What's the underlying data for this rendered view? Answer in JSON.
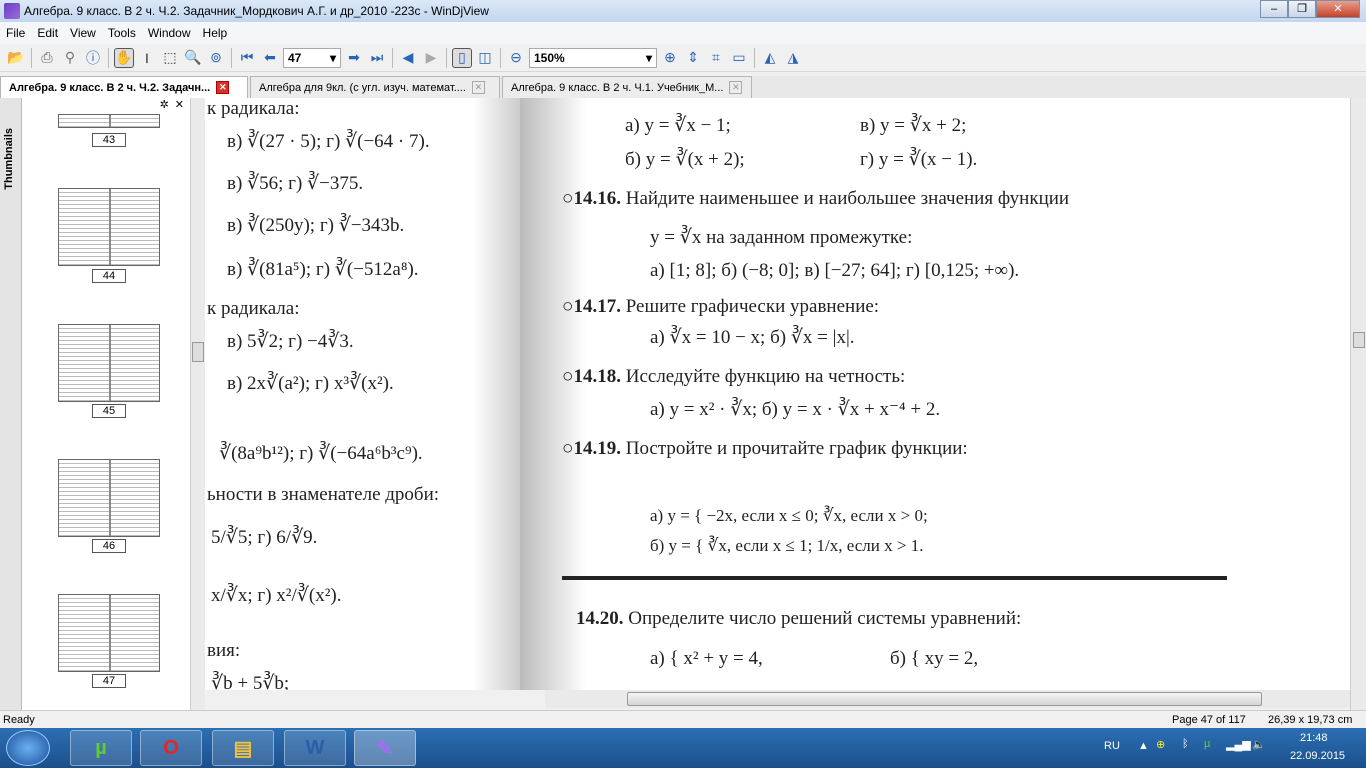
{
  "window": {
    "title": "Алгебра. 9 класс. В 2 ч. Ч.2. Задачник_Мордкович А.Г. и др_2010 -223с - WinDjView"
  },
  "menu": [
    "File",
    "Edit",
    "View",
    "Tools",
    "Window",
    "Help"
  ],
  "toolbar": {
    "page_value": "47",
    "zoom_value": "150%"
  },
  "tabs": [
    {
      "label": "Алгебра. 9 класс. В 2 ч. Ч.2. Задачн...",
      "active": true
    },
    {
      "label": "Алгебра для 9кл. (с угл. изуч. математ...."
    },
    {
      "label": "Алгебра. 9 класс. В 2 ч. Ч.1. Учебник_М..."
    }
  ],
  "sidebar": {
    "tab_label": "Thumbnails",
    "pages": [
      "43",
      "44",
      "45",
      "46",
      "47"
    ]
  },
  "left_page": [
    "к радикала:",
    "в) ∛(27 · 5);     г) ∛(−64 · 7).",
    "в) ∛56;        г) ∛−375.",
    "в) ∛(250y);     г) ∛−343b.",
    "в) ∛(81a⁵);     г) ∛(−512a⁸).",
    "к радикала:",
    "в) 5∛2;        г) −4∛3.",
    "в) 2x∛(a²);     г) x³∛(x²).",
    "∛(8a⁹b¹²);     г) ∛(−64a⁶b³c⁹).",
    "ьности в знаменателе дроби:",
    "5/∛5;       г) 6/∛9.",
    "x/∛x;       г) x²/∛(x²).",
    "вия:",
    "∛b + 5∛b;"
  ],
  "right_page": {
    "top": [
      "а) y = ∛x − 1;",
      "в) y = ∛x + 2;",
      "б) y = ∛(x + 2);",
      "г) y = ∛(x − 1)."
    ],
    "problems": [
      {
        "num": "○14.16.",
        "text": "Найдите наименьшее и наибольшее значения функции",
        "lines": [
          "y = ∛x на заданном промежутке:",
          "а) [1; 8];     б) (−8; 0];     в) [−27; 64];     г) [0,125; +∞)."
        ]
      },
      {
        "num": "○14.17.",
        "text": "Решите графически уравнение:",
        "lines": [
          "а) ∛x = 10 − x;        б) ∛x = |x|."
        ]
      },
      {
        "num": "○14.18.",
        "text": "Исследуйте функцию на четность:",
        "lines": [
          "а) y = x² · ∛x;            б) y = x · ∛x + x⁻⁴ + 2."
        ]
      },
      {
        "num": "○14.19.",
        "text": "Постройте и прочитайте график функции:",
        "lines": [
          "а) y = { −2x, если x ≤ 0;   ∛x, если x > 0;",
          "б) y = { ∛x, если x ≤ 1;   1/x, если x > 1."
        ]
      },
      {
        "num": "14.20.",
        "text": "Определите число решений системы уравнений:",
        "lines": [
          "а) { x² + y = 4,",
          "б) { xy = 2,"
        ]
      }
    ]
  },
  "status": {
    "left": "Ready",
    "page": "Page 47 of 117",
    "size": "26,39 x 19,73 cm"
  },
  "taskbar": {
    "lang": "RU",
    "time": "21:48",
    "date": "22.09.2015",
    "apps": [
      "windows-start",
      "utorrent",
      "opera",
      "explorer",
      "word",
      "windjview"
    ]
  }
}
